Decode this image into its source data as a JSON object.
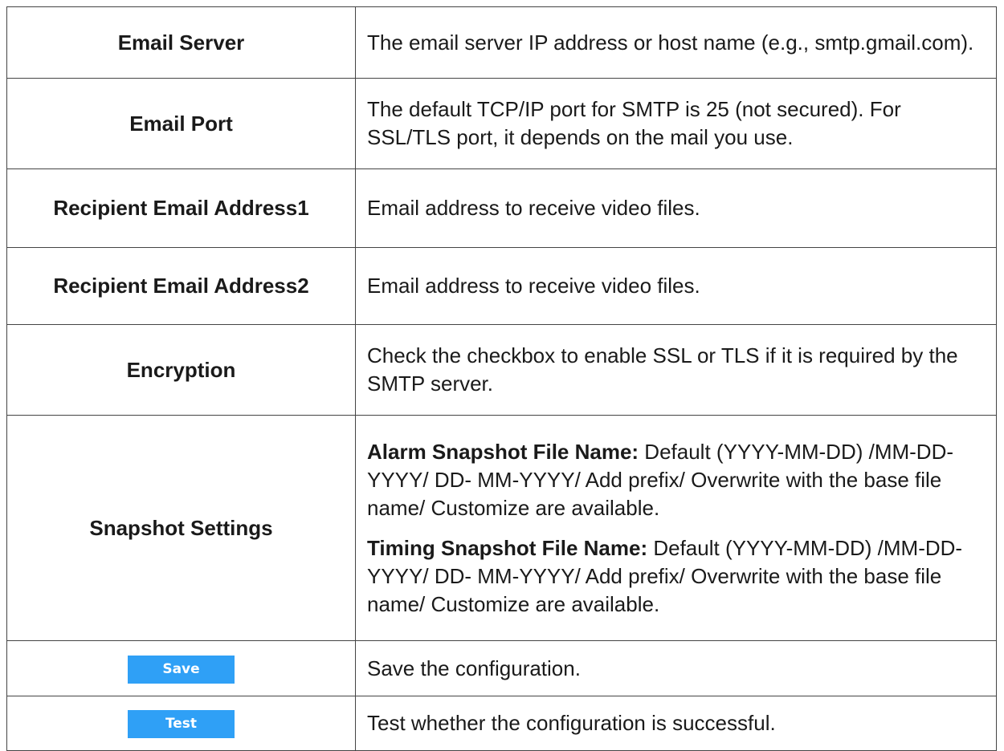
{
  "rows": [
    {
      "label": "Email Server",
      "desc": "The email server IP address or host name (e.g., smtp.gmail.com)."
    },
    {
      "label": "Email Port",
      "desc": "The default TCP/IP port for SMTP is 25 (not secured). For SSL/TLS port, it depends on the mail you use."
    },
    {
      "label": "Recipient Email Address1",
      "desc": "Email address to receive video files."
    },
    {
      "label": "Recipient Email Address2",
      "desc": "Email address to receive video files."
    },
    {
      "label": "Encryption",
      "desc": "Check the checkbox to enable SSL or TLS if it is required by the SMTP server."
    },
    {
      "label": "Snapshot Settings",
      "alarm_title": "Alarm Snapshot File Name:",
      "alarm_desc": " Default (YYYY-MM-DD) /MM-DD-YYYY/ DD- MM-YYYY/ Add prefix/ Overwrite with the base file name/ Customize are available.",
      "timing_title": "Timing Snapshot File Name:",
      "timing_desc": " Default (YYYY-MM-DD) /MM-DD-YYYY/ DD- MM-YYYY/ Add prefix/ Overwrite with the base file name/ Customize are available."
    },
    {
      "button": "Save",
      "desc": "Save the configuration."
    },
    {
      "button": "Test",
      "desc": "Test whether the configuration is successful."
    }
  ],
  "colors": {
    "button_bg": "#2fa0f6",
    "button_text": "#ffffff",
    "border": "#444444"
  }
}
